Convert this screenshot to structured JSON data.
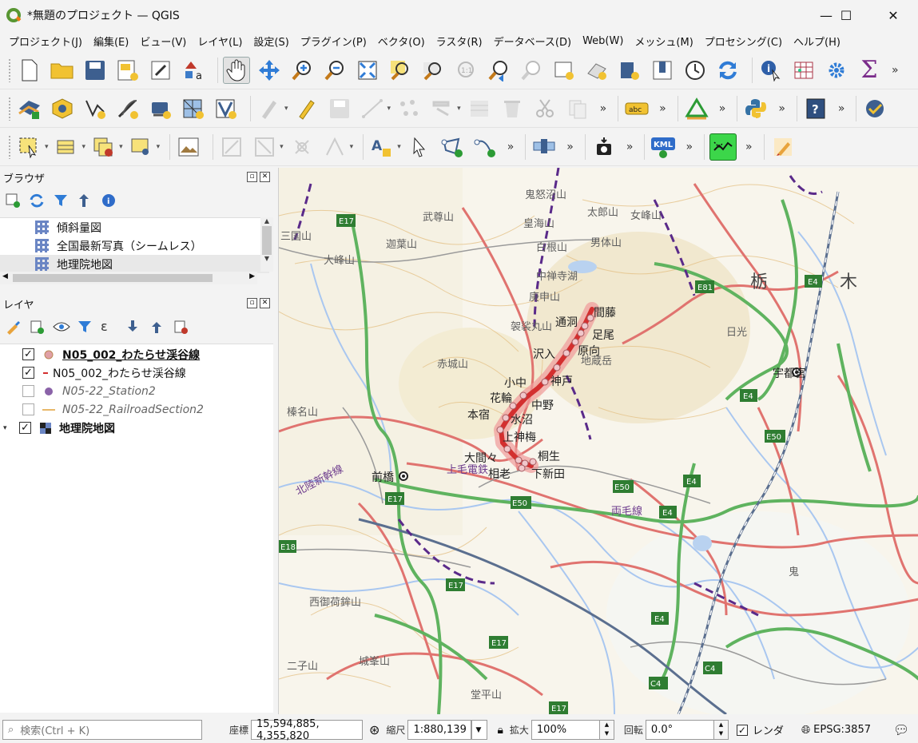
{
  "window": {
    "title": "*無題のプロジェクト — QGIS",
    "minimize": "—",
    "maximize": "☐",
    "close": "✕"
  },
  "menu": [
    "プロジェクト(J)",
    "編集(E)",
    "ビュー(V)",
    "レイヤ(L)",
    "設定(S)",
    "プラグイン(P)",
    "ベクタ(O)",
    "ラスタ(R)",
    "データベース(D)",
    "Web(W)",
    "メッシュ(M)",
    "プロセシング(C)",
    "ヘルプ(H)"
  ],
  "toolbars": {
    "more": "»",
    "abc_label": "abc",
    "kml_label": "KML",
    "sigma": "Σ"
  },
  "browser": {
    "title": "ブラウザ",
    "items": [
      {
        "label": "傾斜量図"
      },
      {
        "label": "全国最新写真（シームレス）"
      },
      {
        "label": "地理院地図"
      }
    ]
  },
  "layers": {
    "title": "レイヤ",
    "items": [
      {
        "label": "N05_002_わたらせ渓谷線",
        "checked": true,
        "style": "bold",
        "symbol": "point-pink"
      },
      {
        "label": "N05_002_わたらせ渓谷線",
        "checked": true,
        "style": "normal",
        "symbol": "line-red"
      },
      {
        "label": "N05-22_Station2",
        "checked": false,
        "style": "italic",
        "symbol": "point-purple"
      },
      {
        "label": "N05-22_RailroadSection2",
        "checked": false,
        "style": "italic",
        "symbol": "line-orange"
      },
      {
        "label": "地理院地図",
        "checked": true,
        "style": "bold",
        "symbol": "raster"
      }
    ],
    "check_mark": "✓"
  },
  "map": {
    "stations": [
      "間藤",
      "通洞",
      "足尾",
      "原向",
      "沢入",
      "神戸",
      "小中",
      "中野",
      "花輪",
      "本宿",
      "水沼",
      "上神梅",
      "大間々",
      "桐生",
      "相老",
      "下新田"
    ],
    "places": [
      "鬼怒沼山",
      "太郎山",
      "女峰山",
      "男体山",
      "武尊山",
      "迦葉山",
      "大峰山",
      "皇海山",
      "白根山",
      "中禅寺湖",
      "庚申山",
      "袈裟丸山",
      "赤城山",
      "地蔵岳",
      "栃",
      "木",
      "宇都宮",
      "前橋",
      "榛名山",
      "北陸新幹線",
      "上毛電鉄",
      "両毛線",
      "西御荷鉾山",
      "城峯山",
      "二子山",
      "堂平山",
      "三国山",
      "鬼",
      "日光"
    ],
    "roads": [
      "E17",
      "E81",
      "E4",
      "E50",
      "E18",
      "C4"
    ],
    "road_color": "#2f7d32"
  },
  "status": {
    "search_placeholder": "検索(Ctrl + K)",
    "coord_label": "座標",
    "coordinate": "15,594,885, 4,355,820",
    "scale_label": "縮尺",
    "scale": "1:880,139",
    "magnifier_label": "拡大",
    "magnifier": "100%",
    "rotation_label": "回転",
    "rotation": "0.0°",
    "render_label": "レンダ",
    "render_checked": true,
    "crs": "EPSG:3857"
  }
}
